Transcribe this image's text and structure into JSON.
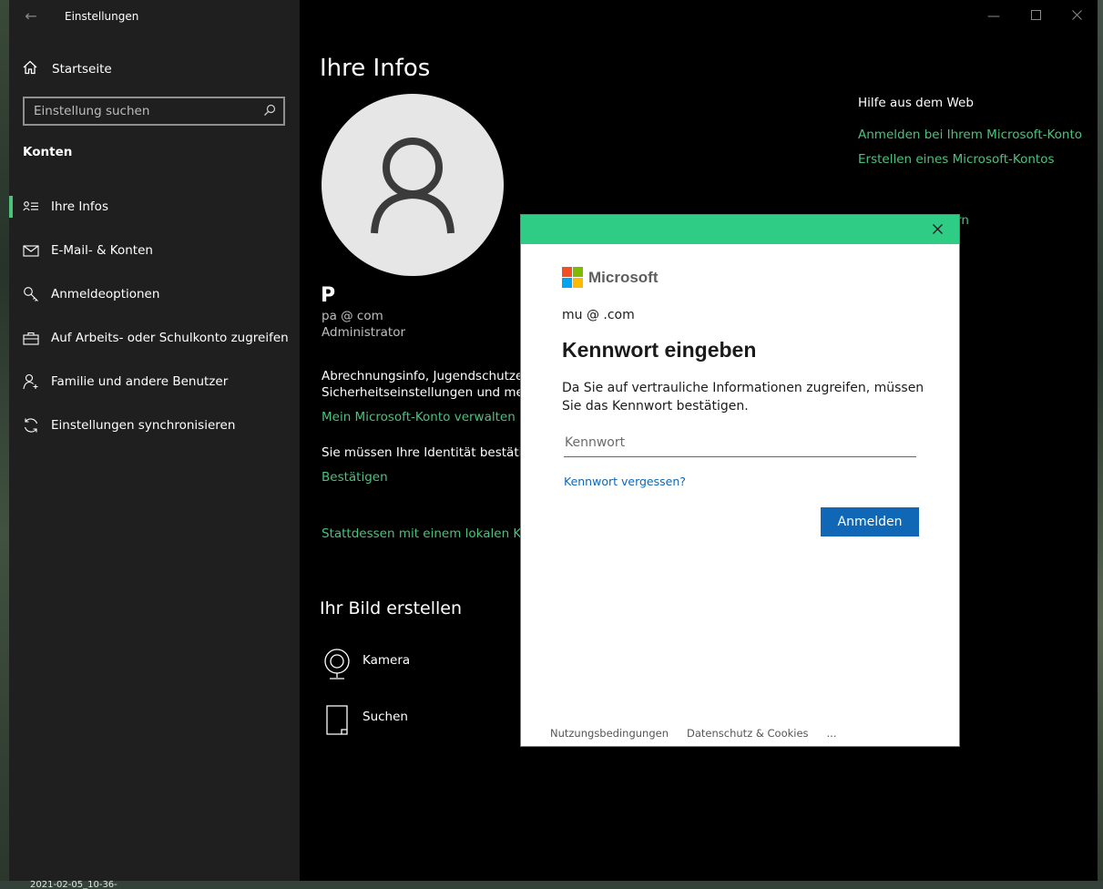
{
  "desktop": {
    "timestamp": "2021-02-05_10-36-"
  },
  "window": {
    "title": "Einstellungen",
    "controls": {
      "minimize_icon": "minimize-icon",
      "maximize_icon": "maximize-icon",
      "close_icon": "close-icon"
    }
  },
  "sidebar": {
    "home_label": "Startseite",
    "search_placeholder": "Einstellung suchen",
    "section_title": "Konten",
    "items": [
      {
        "label": "Ihre Infos",
        "icon": "person-card-icon",
        "active": true
      },
      {
        "label": "E-Mail- & Konten",
        "icon": "mail-icon"
      },
      {
        "label": "Anmeldeoptionen",
        "icon": "key-icon"
      },
      {
        "label": "Auf Arbeits- oder Schulkonto zugreifen",
        "icon": "briefcase-icon"
      },
      {
        "label": "Familie und andere Benutzer",
        "icon": "person-add-icon"
      },
      {
        "label": "Einstellungen synchronisieren",
        "icon": "sync-icon"
      }
    ]
  },
  "main": {
    "title": "Ihre Infos",
    "user": {
      "name": "P",
      "email": "pa              @          com",
      "role": "Administrator"
    },
    "billing_line1": "Abrechnungsinfo, Jugendschutzeins",
    "billing_line2": "Sicherheitseinstellungen und mehr",
    "manage_link": "Mein Microsoft-Konto verwalten",
    "verify_text": "Sie müssen Ihre Identität bestätiger",
    "verify_link": "Bestätigen",
    "local_link": "Stattdessen mit einem lokalen Kont",
    "picture_title": "Ihr Bild erstellen",
    "camera_label": "Kamera",
    "browse_label": "Suchen"
  },
  "help": {
    "title": "Hilfe aus dem Web",
    "links": [
      "Anmelden bei Ihrem Microsoft-Konto",
      "Erstellen eines Microsoft-Kontos"
    ],
    "partial_link": "rn"
  },
  "dialog": {
    "brand": "Microsoft",
    "email": "mu               @          .com",
    "title": "Kennwort eingeben",
    "description": "Da Sie auf vertrauliche Informationen zugreifen, müssen Sie das Kennwort bestätigen.",
    "password_placeholder": "Kennwort",
    "password_value": "",
    "forgot_link": "Kennwort vergessen?",
    "signin_button": "Anmelden",
    "footer": {
      "terms": "Nutzungsbedingungen",
      "privacy": "Datenschutz & Cookies",
      "more": "..."
    },
    "colors": {
      "header_bar": "#2ecc85",
      "primary_button": "#0f67b5"
    }
  },
  "colors": {
    "accent_green": "#4cc27b",
    "sidebar_bg": "#1f1f1f",
    "content_bg": "#000000"
  }
}
